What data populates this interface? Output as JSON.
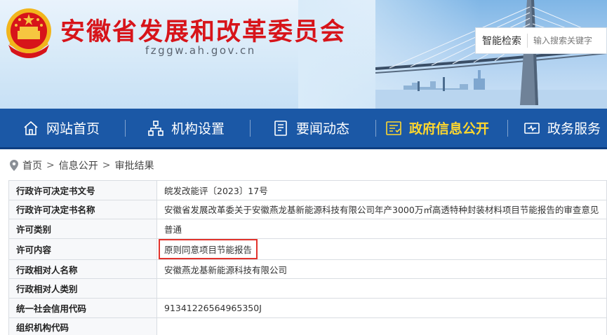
{
  "header": {
    "title": "安徽省发展和改革委员会",
    "domain": "fzggw.ah.gov.cn",
    "search": {
      "label": "智能检索",
      "placeholder": "输入搜索关键字"
    }
  },
  "nav": {
    "items": [
      {
        "label": "网站首页",
        "icon": "home-icon",
        "active": false
      },
      {
        "label": "机构设置",
        "icon": "org-chart-icon",
        "active": false
      },
      {
        "label": "要闻动态",
        "icon": "news-icon",
        "active": false
      },
      {
        "label": "政府信息公开",
        "icon": "info-disclosure-icon",
        "active": true
      },
      {
        "label": "政务服务",
        "icon": "service-icon",
        "active": false
      }
    ]
  },
  "breadcrumb": {
    "items": [
      "首页",
      "信息公开",
      "审批结果"
    ],
    "separator": ">"
  },
  "table": {
    "rows": [
      {
        "label": "行政许可决定书文号",
        "value": "皖发改能评〔2023〕17号"
      },
      {
        "label": "行政许可决定书名称",
        "value": "安徽省发展改革委关于安徽燕龙基新能源科技有限公司年产3000万㎡高透特种封装材料项目节能报告的审查意见"
      },
      {
        "label": "许可类别",
        "value": "普通"
      },
      {
        "label": "许可内容",
        "value": "原则同意项目节能报告"
      },
      {
        "label": "行政相对人名称",
        "value": "安徽燕龙基新能源科技有限公司"
      },
      {
        "label": "行政相对人类别",
        "value": ""
      },
      {
        "label": "统一社会信用代码",
        "value": "91341226564965350J"
      },
      {
        "label": "组织机构代码",
        "value": ""
      }
    ]
  },
  "colors": {
    "title_red": "#d7141a",
    "nav_blue": "#1b58a6",
    "nav_active": "#ffd72e",
    "highlight_border": "#e2322b"
  }
}
